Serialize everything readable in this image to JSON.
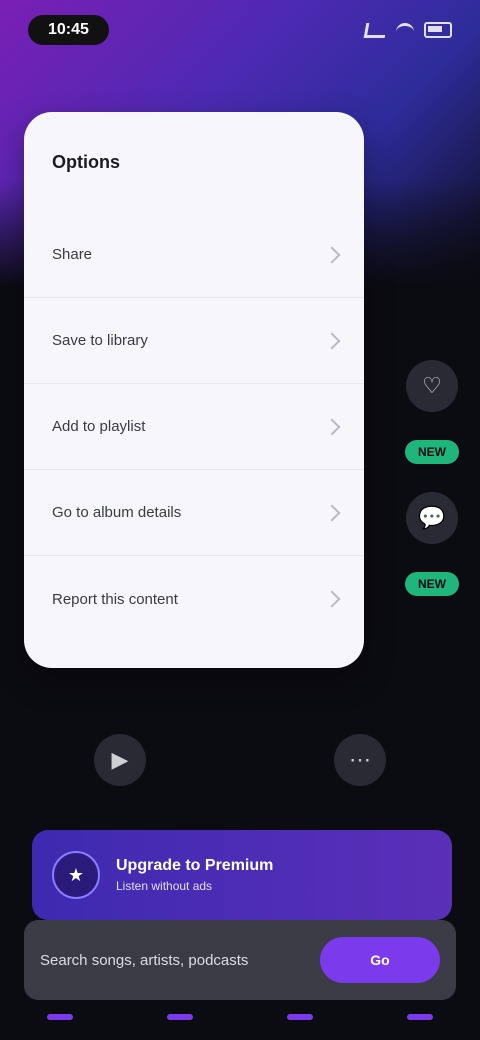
{
  "status": {
    "time": "10:45"
  },
  "sheet": {
    "title": "Options",
    "items": [
      {
        "label": "Share"
      },
      {
        "label": "Save to library"
      },
      {
        "label": "Add to playlist"
      },
      {
        "label": "Go to album details"
      },
      {
        "label": "Report this content"
      }
    ]
  },
  "side_actions": [
    {
      "icon": "heart-icon"
    },
    {
      "icon": "green-pill",
      "label": "NEW"
    },
    {
      "icon": "comment-icon"
    },
    {
      "icon": "green-pill",
      "label": "NEW"
    }
  ],
  "promo": {
    "title": "Upgrade to Premium",
    "subtitle": "Listen without ads"
  },
  "search": {
    "placeholder": "Search songs, artists, podcasts",
    "button_label": "Go"
  },
  "colors": {
    "accent": "#7c3aed",
    "green": "#1fb67c"
  }
}
